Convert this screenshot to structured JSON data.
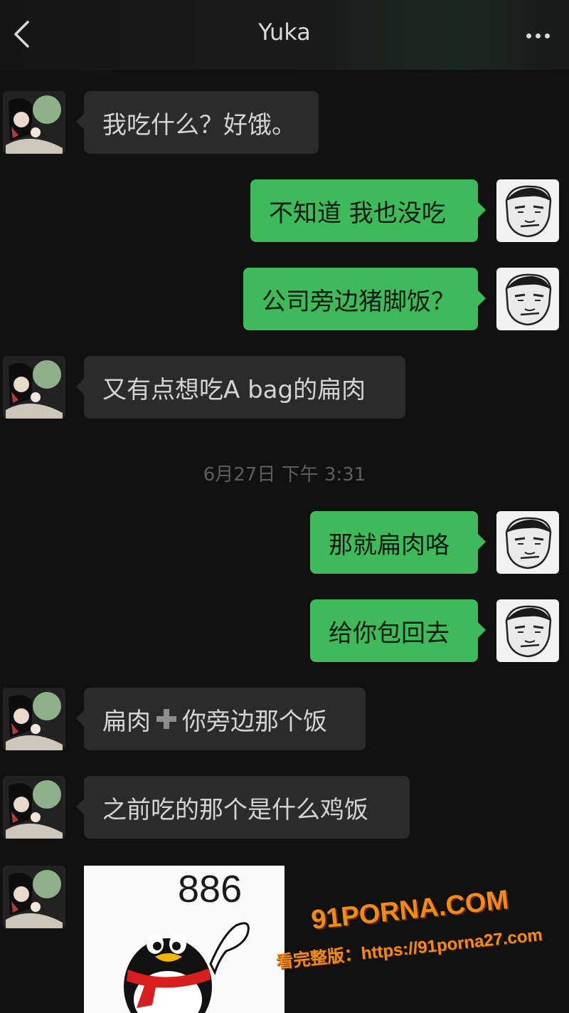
{
  "header": {
    "title": "Yuka",
    "back_icon": "chevron-left-icon",
    "more_icon": "more-dots-icon"
  },
  "messages": [
    {
      "from": "them",
      "text": "我吃什么？好饿。"
    },
    {
      "from": "me",
      "text": "不知道 我也没吃"
    },
    {
      "from": "me",
      "text": "公司旁边猪脚饭？"
    },
    {
      "from": "them",
      "text": "又有点想吃A bag的扁肉"
    },
    {
      "from": "me",
      "text": "那就扁肉咯"
    },
    {
      "from": "me",
      "text": "给你包回去"
    },
    {
      "from": "them",
      "text_before": "扁肉",
      "icon": "plus-icon",
      "text_after": "你旁边那个饭"
    },
    {
      "from": "them",
      "text": "之前吃的那个是什么鸡饭"
    },
    {
      "from": "them",
      "sticker_text": "886"
    }
  ],
  "timestamp": "6月27日 下午 3:31",
  "watermark": {
    "logo": "91PORNA.COM",
    "text": "看完整版：https://91porna27.com"
  },
  "colors": {
    "background": "#111111",
    "incoming_bubble": "#2b2b2b",
    "outgoing_bubble": "#3fba5a",
    "watermark": "#f28a1a"
  }
}
